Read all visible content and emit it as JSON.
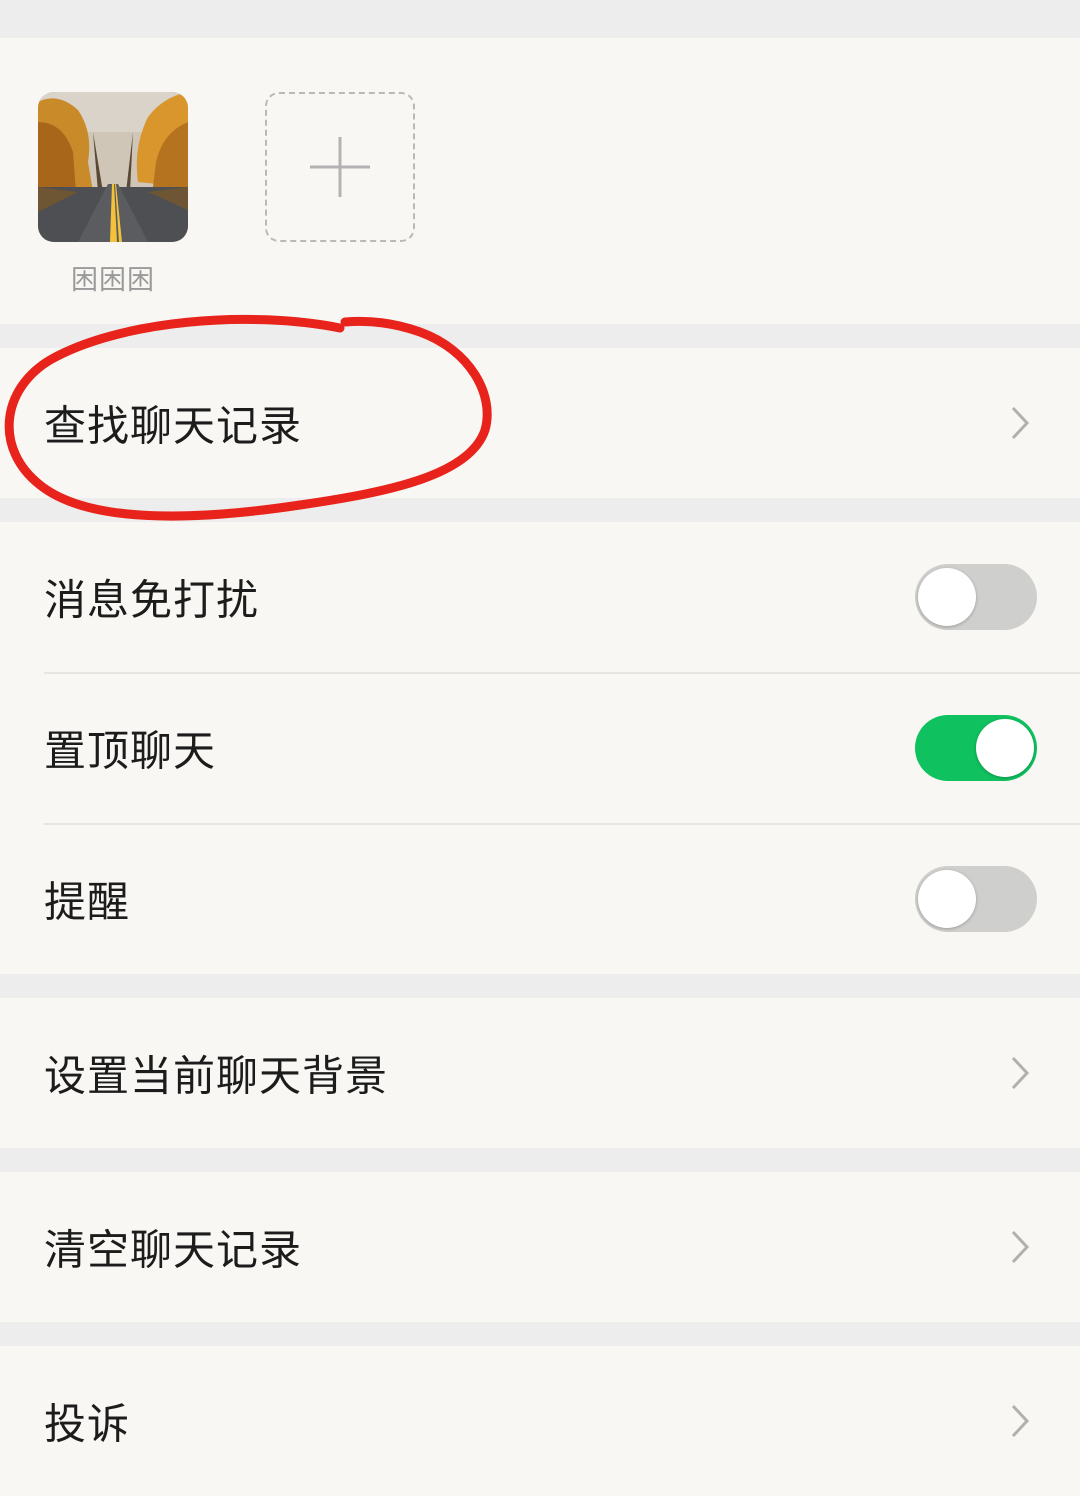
{
  "members": [
    {
      "name": "困困困",
      "avatar": "autumn-road-photo"
    }
  ],
  "add_member_icon": "plus-icon",
  "rows": {
    "search_history": {
      "label": "查找聊天记录",
      "icon": "chevron-right-icon"
    },
    "mute": {
      "label": "消息免打扰",
      "enabled": false
    },
    "pin_chat": {
      "label": "置顶聊天",
      "enabled": true
    },
    "remind": {
      "label": "提醒",
      "enabled": false
    },
    "chat_background": {
      "label": "设置当前聊天背景",
      "icon": "chevron-right-icon"
    },
    "clear_history": {
      "label": "清空聊天记录",
      "icon": "chevron-right-icon"
    },
    "complain": {
      "label": "投诉",
      "icon": "chevron-right-icon"
    }
  },
  "colors": {
    "toggle_on": "#10c160",
    "toggle_off": "#cfcfcd",
    "annotation_circle": "#e8231b",
    "background": "#ededed",
    "cell": "#f8f7f3"
  }
}
